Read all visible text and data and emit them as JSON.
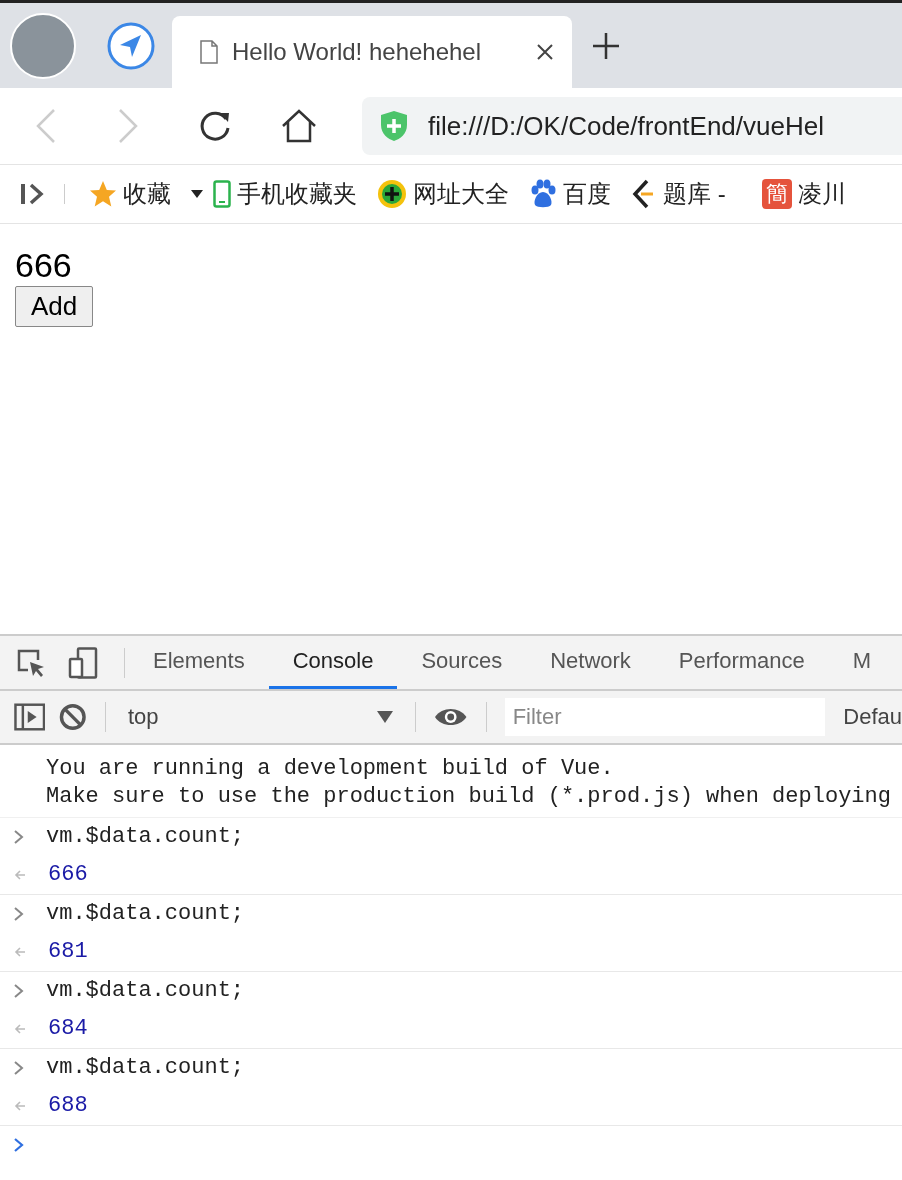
{
  "browser": {
    "tab": {
      "title": "Hello World! hehehehel"
    },
    "address": "file:///D:/OK/Code/frontEnd/vueHel",
    "bookmarks": [
      {
        "kind": "star",
        "label": "收藏"
      },
      {
        "kind": "phone",
        "label": "手机收藏夹"
      },
      {
        "kind": "plus",
        "label": "网址大全"
      },
      {
        "kind": "paw",
        "label": "百度"
      },
      {
        "kind": "bracket",
        "label": "题库 -"
      },
      {
        "kind": "badge",
        "badge": "簡",
        "label": "凌川"
      }
    ]
  },
  "page": {
    "count": "666",
    "button": "Add"
  },
  "devtools": {
    "tabs": [
      {
        "label": "Elements",
        "selected": false
      },
      {
        "label": "Console",
        "selected": true
      },
      {
        "label": "Sources",
        "selected": false
      },
      {
        "label": "Network",
        "selected": false
      },
      {
        "label": "Performance",
        "selected": false
      },
      {
        "label": "M",
        "selected": false
      }
    ],
    "context": "top",
    "filter_placeholder": "Filter",
    "levels": "Defau",
    "console": [
      {
        "kind": "message",
        "lines": [
          "You are running a development build of Vue.",
          "Make sure to use the production build (*.prod.js) when deploying"
        ]
      },
      {
        "kind": "input",
        "text": "vm.$data.count;"
      },
      {
        "kind": "result",
        "text": "666"
      },
      {
        "kind": "input",
        "text": "vm.$data.count;"
      },
      {
        "kind": "result",
        "text": "681"
      },
      {
        "kind": "input",
        "text": "vm.$data.count;"
      },
      {
        "kind": "result",
        "text": "684"
      },
      {
        "kind": "input",
        "text": "vm.$data.count;"
      },
      {
        "kind": "result",
        "text": "688"
      },
      {
        "kind": "prompt"
      }
    ]
  }
}
